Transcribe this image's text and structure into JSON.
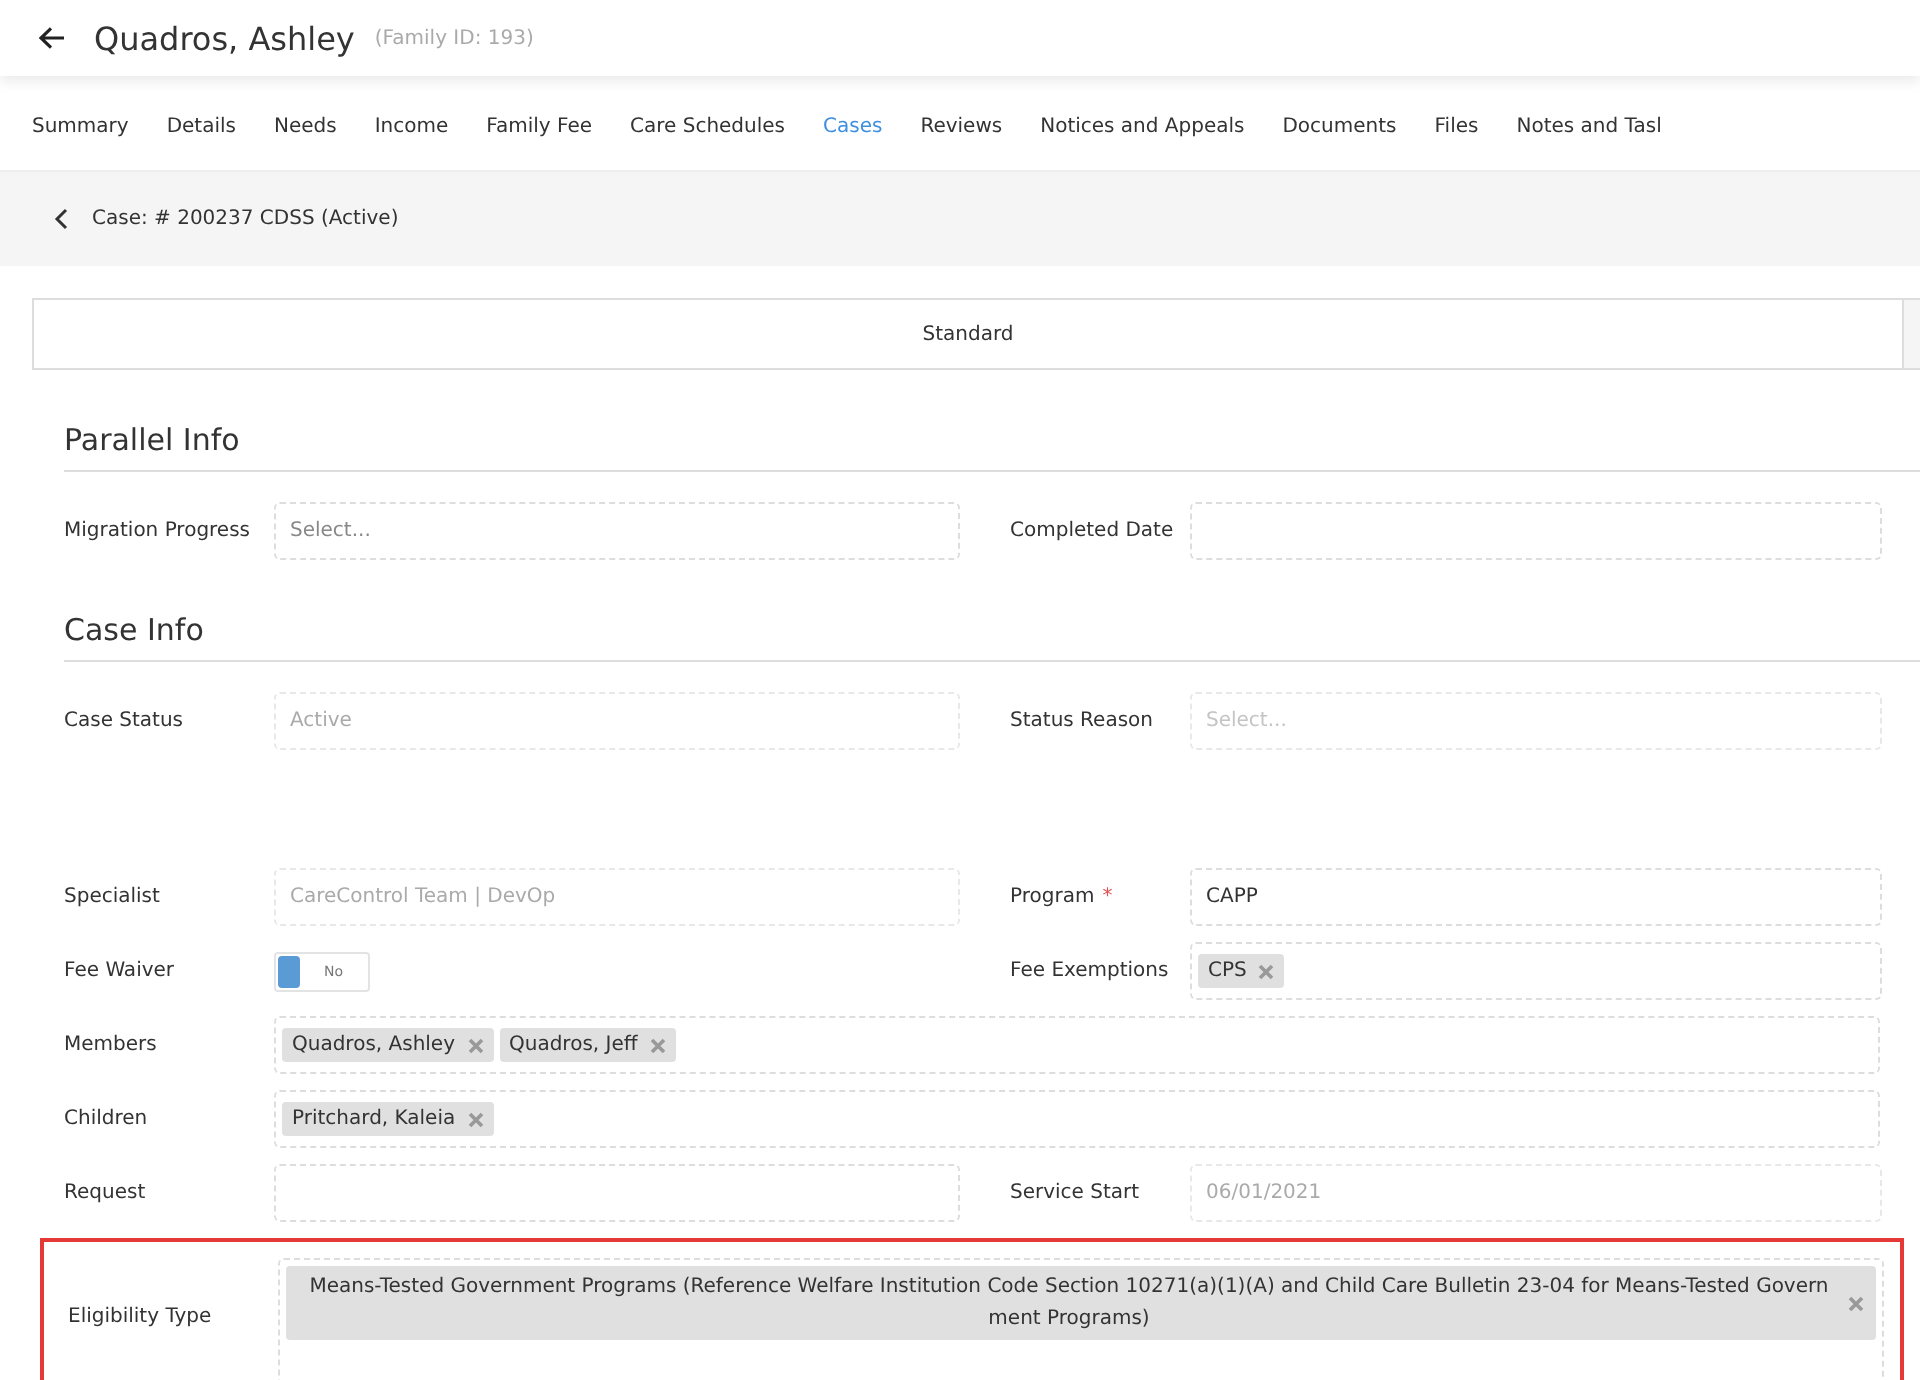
{
  "header": {
    "title": "Quadros, Ashley",
    "family_id": "(Family ID: 193)"
  },
  "tabs": [
    {
      "label": "Summary",
      "selected": false
    },
    {
      "label": "Details",
      "selected": false
    },
    {
      "label": "Needs",
      "selected": false
    },
    {
      "label": "Income",
      "selected": false
    },
    {
      "label": "Family Fee",
      "selected": false
    },
    {
      "label": "Care Schedules",
      "selected": false
    },
    {
      "label": "Cases",
      "selected": true
    },
    {
      "label": "Reviews",
      "selected": false
    },
    {
      "label": "Notices and Appeals",
      "selected": false
    },
    {
      "label": "Documents",
      "selected": false
    },
    {
      "label": "Files",
      "selected": false
    },
    {
      "label": "Notes and Tasl",
      "selected": false
    }
  ],
  "breadcrumb": "Case: # 200237 CDSS (Active)",
  "view_tabs": [
    {
      "label": "Standard",
      "selected": true
    }
  ],
  "sections": [
    {
      "title": "Parallel Info",
      "rows": [
        [
          {
            "label": "Migration Progress",
            "kind": "select",
            "placeholder": "Select..."
          },
          {
            "label": "Completed Date",
            "kind": "text"
          }
        ]
      ]
    },
    {
      "title": "Case Info",
      "rows": [
        [
          {
            "label": "Case Status",
            "kind": "text",
            "value": "Active",
            "disabled": true
          },
          {
            "label": "Status Reason",
            "kind": "select",
            "placeholder": "Select...",
            "disabled": true
          }
        ],
        [
          {
            "label": "Specialist",
            "kind": "text",
            "value": "CareControl Team | DevOp",
            "disabled": true
          },
          {
            "label": "Program",
            "kind": "text",
            "value": "CAPP",
            "required": true,
            "required_mark": "*"
          }
        ],
        [
          {
            "label": "Fee Waiver",
            "kind": "toggle",
            "on": false,
            "toggle_label": "No"
          },
          {
            "label": "Fee Exemptions",
            "kind": "tags",
            "tags": [
              "CPS"
            ]
          }
        ],
        [
          {
            "label": "Members",
            "kind": "tags",
            "tags": [
              "Quadros, Ashley",
              "Quadros, Jeff"
            ]
          }
        ],
        [
          {
            "label": "Children",
            "kind": "tags",
            "tags": [
              "Pritchard, Kaleia"
            ]
          }
        ],
        [
          {
            "label": "Request",
            "kind": "text"
          },
          {
            "label": "Service Start",
            "kind": "text",
            "value": "06/01/2021",
            "disabled": true
          }
        ],
        [
          {
            "label": "Eligibility Type",
            "kind": "tags",
            "highlighted": true,
            "tags": [
              "Means-Tested Government Programs (Reference Welfare Institution Code Section 10271(a)(1)(A) and Child Care Bulletin 23-04 for Means-Tested Government Programs)"
            ]
          }
        ]
      ]
    }
  ]
}
